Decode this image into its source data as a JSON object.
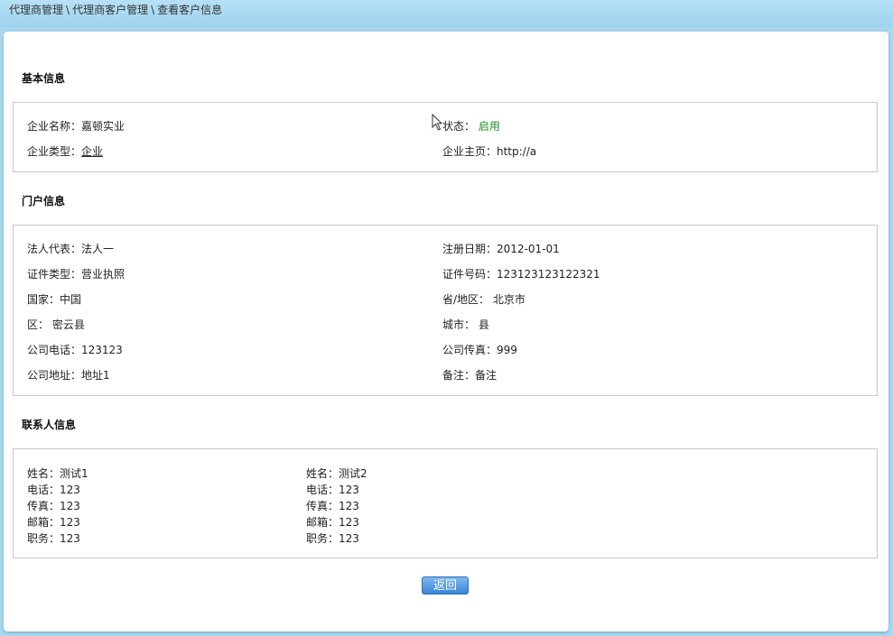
{
  "breadcrumb": {
    "items": [
      "代理商管理",
      "代理商客户管理",
      "查看客户信息"
    ],
    "separator": "\\"
  },
  "basic": {
    "title": "基本信息",
    "company_name": "企业名称：嘉顿实业",
    "status_label": "状态：",
    "status_value": "启用",
    "company_type_label": "企业类型：",
    "company_type_value": "企业",
    "homepage": "企业主页：http://a"
  },
  "portal": {
    "title": "门户信息",
    "legal_rep": "法人代表：法人一",
    "reg_date": "注册日期：2012-01-01",
    "cert_type": "证件类型：营业执照",
    "cert_no": "证件号码：123123123122321",
    "country": "国家：中国",
    "province": "省/地区： 北京市",
    "district": "区： 密云县",
    "city": "城市： 县",
    "phone": "公司电话：123123",
    "fax": "公司传真：999",
    "address": "公司地址：地址1",
    "remark": "备注：备注"
  },
  "contacts": {
    "title": "联系人信息",
    "items": [
      {
        "name": "姓名：测试1",
        "phone": "电话：123",
        "fax": "传真：123",
        "email": "邮箱：123",
        "position": "职务：123"
      },
      {
        "name": "姓名：测试2",
        "phone": "电话：123",
        "fax": "传真：123",
        "email": "邮箱：123",
        "position": "职务：123"
      }
    ]
  },
  "actions": {
    "back_label": "返回"
  },
  "colors": {
    "status_green": "#1c8c1c",
    "button_blue": "#3b86d8",
    "header_bg": "#a8d8f0"
  }
}
